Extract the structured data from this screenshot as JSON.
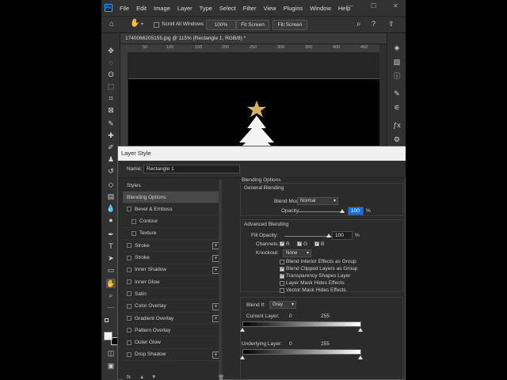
{
  "menubar": {
    "logo": "Ps",
    "items": [
      "File",
      "Edit",
      "Image",
      "Layer",
      "Type",
      "Select",
      "Filter",
      "View",
      "Plugins",
      "Window",
      "Help"
    ]
  },
  "options_bar": {
    "scroll_all_windows": "Scroll All Windows",
    "zoom_100": "100%",
    "fit_screen": "Fit Screen",
    "fill_screen": "Fill Screen"
  },
  "document": {
    "tab_title": "1740066205155.jpg @ 115% (Rectangle 1, RGB/8) *",
    "ruler_marks": [
      "50",
      "100",
      "150",
      "200",
      "250",
      "300",
      "350",
      "400",
      "450"
    ]
  },
  "layer_style": {
    "title": "Layer Style",
    "name_label": "Name:",
    "name_value": "Rectangle 1",
    "styles_header": "Styles",
    "style_items": [
      {
        "label": "Blending Options",
        "checkbox": false,
        "plus": false,
        "selected": true,
        "indent": false
      },
      {
        "label": "Bevel & Emboss",
        "checkbox": true,
        "plus": false,
        "selected": false,
        "indent": false
      },
      {
        "label": "Contour",
        "checkbox": true,
        "plus": false,
        "selected": false,
        "indent": true
      },
      {
        "label": "Texture",
        "checkbox": true,
        "plus": false,
        "selected": false,
        "indent": true
      },
      {
        "label": "Stroke",
        "checkbox": true,
        "plus": true,
        "selected": false,
        "indent": false
      },
      {
        "label": "Stroke",
        "checkbox": true,
        "plus": true,
        "selected": false,
        "indent": false
      },
      {
        "label": "Inner Shadow",
        "checkbox": true,
        "plus": true,
        "selected": false,
        "indent": false
      },
      {
        "label": "Inner Glow",
        "checkbox": true,
        "plus": false,
        "selected": false,
        "indent": false
      },
      {
        "label": "Satin",
        "checkbox": true,
        "plus": false,
        "selected": false,
        "indent": false
      },
      {
        "label": "Color Overlay",
        "checkbox": true,
        "plus": true,
        "selected": false,
        "indent": false
      },
      {
        "label": "Gradient Overlay",
        "checkbox": true,
        "plus": true,
        "selected": false,
        "indent": false
      },
      {
        "label": "Pattern Overlay",
        "checkbox": true,
        "plus": false,
        "selected": false,
        "indent": false
      },
      {
        "label": "Outer Glow",
        "checkbox": true,
        "plus": false,
        "selected": false,
        "indent": false
      },
      {
        "label": "Drop Shadow",
        "checkbox": true,
        "plus": true,
        "selected": false,
        "indent": false
      }
    ],
    "footer_fx": "fx",
    "blending_options": {
      "header": "Blending Options",
      "general_blending": "General Blending",
      "blend_mode_label": "Blend Mode:",
      "blend_mode_value": "Normal",
      "opacity_label": "Opacity:",
      "opacity_value": "100",
      "percent": "%",
      "advanced_blending": "Advanced Blending",
      "fill_opacity_label": "Fill Opacity:",
      "fill_opacity_value": "100",
      "channels_label": "Channels:",
      "channel_r": "R",
      "channel_g": "G",
      "channel_b": "B",
      "knockout_label": "Knockout:",
      "knockout_value": "None",
      "checks": [
        {
          "label": "Blend Interior Effects as Group",
          "checked": false
        },
        {
          "label": "Blend Clipped Layers as Group",
          "checked": true
        },
        {
          "label": "Transparency Shapes Layer",
          "checked": true
        },
        {
          "label": "Layer Mask Hides Effects",
          "checked": false
        },
        {
          "label": "Vector Mask Hides Effects",
          "checked": false
        }
      ],
      "blend_if_label": "Blend If:",
      "blend_if_value": "Gray",
      "current_layer_label": "Current Layer:",
      "current_layer_min": "0",
      "current_layer_max": "255",
      "underlying_layer_label": "Underlying Layer:",
      "underlying_layer_min": "0",
      "underlying_layer_max": "255"
    }
  },
  "colors": {
    "accent": "#31a8ff",
    "selection_highlight": "#1473e6",
    "panel": "#2b2b2b"
  }
}
